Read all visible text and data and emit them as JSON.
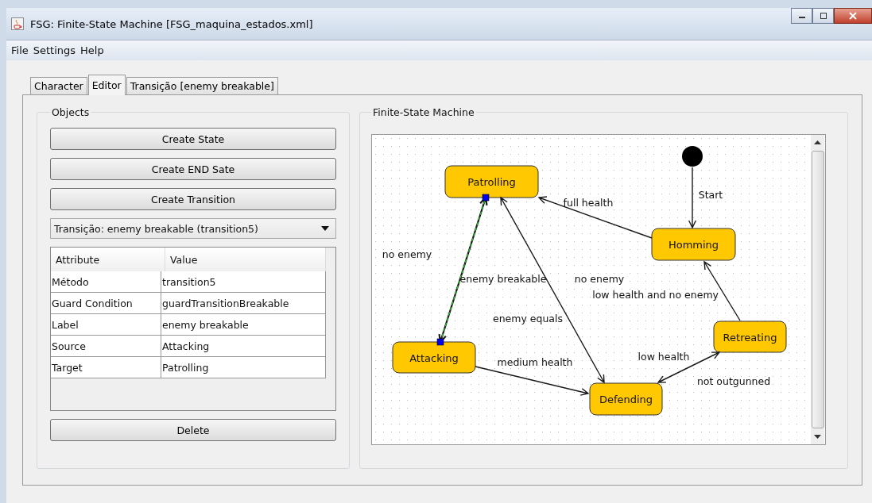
{
  "window": {
    "title": "FSG: Finite-State Machine [FSG_maquina_estados.xml]"
  },
  "menu": [
    "File",
    "Settings",
    "Help"
  ],
  "tabs": [
    {
      "label": "Character",
      "selected": false
    },
    {
      "label": "Editor",
      "selected": true
    },
    {
      "label": "Transição [enemy breakable]",
      "selected": false
    }
  ],
  "objects": {
    "title": "Objects",
    "buttons": [
      "Create State",
      "Create END Sate",
      "Create Transition"
    ],
    "dropdown": {
      "value": "Transição: enemy breakable (transition5)"
    },
    "table": {
      "columns": [
        "Attribute",
        "Value"
      ],
      "rows": [
        [
          "Método",
          "transition5"
        ],
        [
          "Guard Condition",
          "guardTransitionBreakable"
        ],
        [
          "Label",
          "enemy breakable"
        ],
        [
          "Source",
          "Attacking"
        ],
        [
          "Target",
          "Patrolling"
        ]
      ]
    },
    "delete_button": "Delete"
  },
  "diagram": {
    "title": "Finite-State Machine",
    "states": [
      {
        "name": "Patrolling"
      },
      {
        "name": "Homming"
      },
      {
        "name": "Retreating"
      },
      {
        "name": "Attacking"
      },
      {
        "name": "Defending"
      }
    ],
    "transitions": [
      {
        "labels": [
          "Start"
        ],
        "selected": false
      },
      {
        "labels": [
          "full health"
        ],
        "selected": false
      },
      {
        "labels": [
          "no enemy",
          "enemy breakable"
        ],
        "selected": true
      },
      {
        "labels": [
          "no enemy",
          "enemy equals"
        ],
        "selected": false
      },
      {
        "labels": [
          "medium health"
        ],
        "selected": false
      },
      {
        "labels": [
          "low health and no enemy"
        ],
        "selected": false
      },
      {
        "labels": [
          "low health",
          "not outgunned"
        ],
        "selected": false
      }
    ]
  }
}
